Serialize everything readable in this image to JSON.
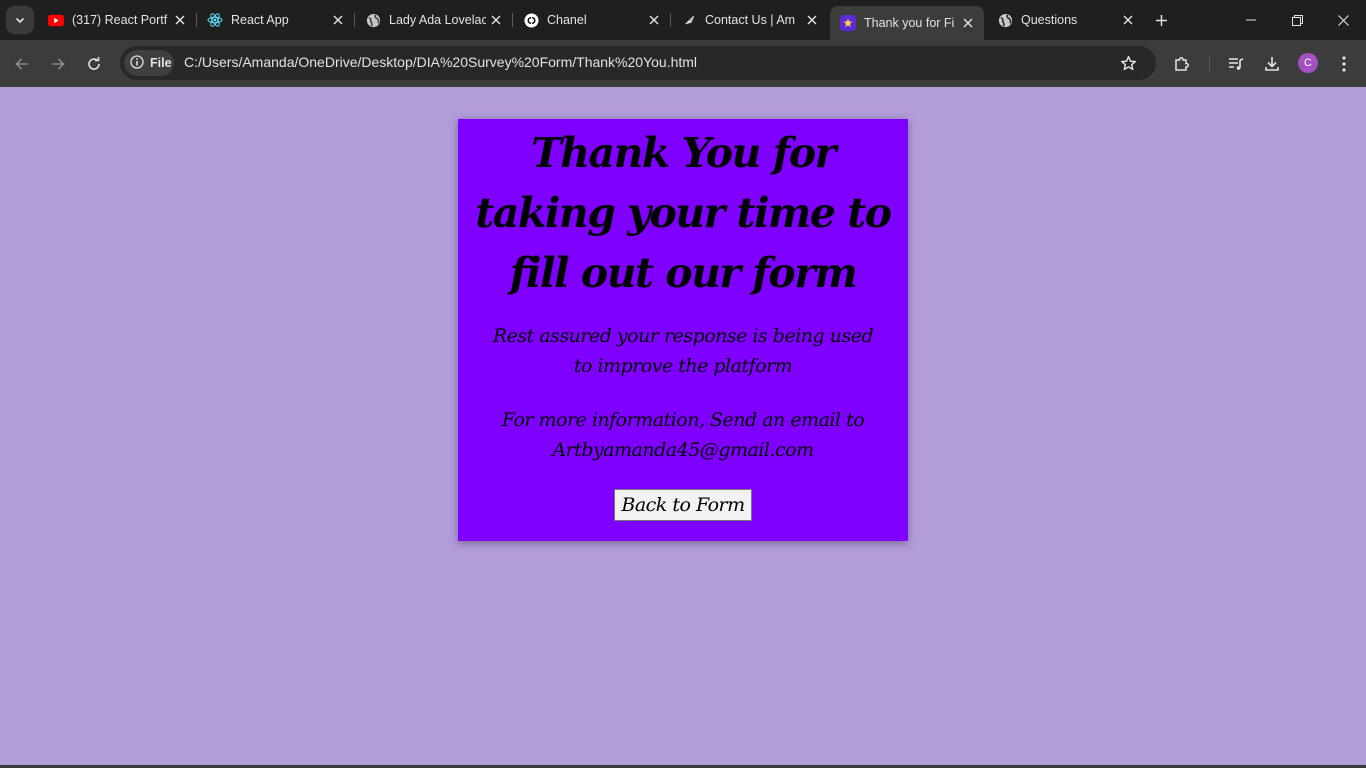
{
  "browser": {
    "tabs": [
      {
        "title": "(317) React Portf",
        "icon": "youtube-icon"
      },
      {
        "title": "React App",
        "icon": "react-icon"
      },
      {
        "title": "Lady Ada Lovelac",
        "icon": "globe-icon"
      },
      {
        "title": "Chanel",
        "icon": "chanel-icon"
      },
      {
        "title": "Contact Us | Am",
        "icon": "brush-icon"
      },
      {
        "title": "Thank you for Fi",
        "icon": "survey-icon",
        "active": true
      },
      {
        "title": "Questions",
        "icon": "globe-icon"
      }
    ],
    "address_chip": "File",
    "url": "C:/Users/Amanda/OneDrive/Desktop/DIA%20Survey%20Form/Thank%20You.html",
    "profile_initial": "C"
  },
  "page": {
    "heading": "Thank You for taking your time to fill out our form",
    "message": "Rest assured your response is being used to improve the platform",
    "contact": "For more information, Send an email to Artbyamanda45@gmail.com",
    "back_button": "Back to Form"
  },
  "colors": {
    "page_background": "#b29ddb",
    "card_background": "#8000ff",
    "tabstrip": "#1f1f1f",
    "toolbar": "#3c3c3c"
  }
}
